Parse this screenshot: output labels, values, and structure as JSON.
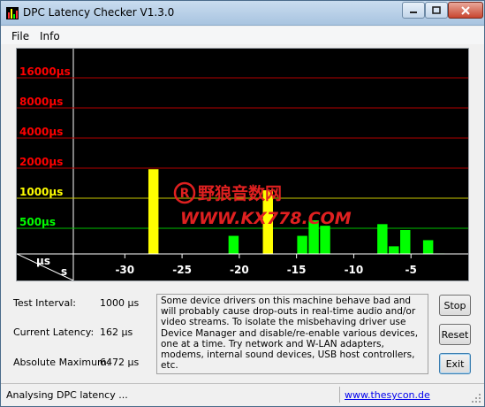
{
  "window": {
    "title": "DPC Latency Checker V1.3.0",
    "icon": "bar-chart-icon"
  },
  "menu": {
    "file": "File",
    "info": "Info"
  },
  "chart_data": {
    "type": "bar",
    "y_scale": "log",
    "y_tick_labels": [
      {
        "label": "16000µs",
        "value": 16000,
        "color": "#ff0000"
      },
      {
        "label": "8000µs",
        "value": 8000,
        "color": "#ff0000"
      },
      {
        "label": "4000µs",
        "value": 4000,
        "color": "#ff0000"
      },
      {
        "label": "2000µs",
        "value": 2000,
        "color": "#ff0000"
      },
      {
        "label": "1000µs",
        "value": 1000,
        "color": "#ffff00"
      },
      {
        "label": "500µs",
        "value": 500,
        "color": "#00ff00"
      }
    ],
    "x_tick_labels": [
      "-30",
      "-25",
      "-20",
      "-15",
      "-10",
      "-5"
    ],
    "x_ticks": [
      -30,
      -25,
      -20,
      -15,
      -10,
      -5
    ],
    "x_range": [
      -34.5,
      0
    ],
    "corner_labels": {
      "y_unit": "µs",
      "x_unit": "s"
    },
    "x": [
      -33.5,
      -32.5,
      -31.5,
      -30.5,
      -29.5,
      -28.5,
      -27.5,
      -26.5,
      -25.5,
      -24.5,
      -23.5,
      -22.5,
      -21.5,
      -20.5,
      -19.5,
      -18.5,
      -17.5,
      -16.5,
      -15.5,
      -14.5,
      -13.5,
      -12.5,
      -11.5,
      -10.5,
      -9.5,
      -8.5,
      -7.5,
      -6.5,
      -5.5,
      -4.5,
      -3.5,
      -2.5,
      -1.5,
      -0.5
    ],
    "values": [
      220,
      220,
      230,
      230,
      230,
      0,
      1950,
      160,
      170,
      230,
      230,
      220,
      230,
      420,
      230,
      230,
      1200,
      230,
      230,
      420,
      600,
      530,
      230,
      230,
      230,
      230,
      550,
      330,
      480,
      230,
      380,
      280,
      230,
      230
    ],
    "colors": {
      "low": "#00ff00",
      "mid": "#ffff00",
      "high": "#ff0000"
    },
    "thresholds": {
      "mid": 500,
      "high": 2000
    }
  },
  "watermark": {
    "name": "野狼音数网",
    "url": "WWW.KX778.COM",
    "mark": "R"
  },
  "stats": {
    "test_interval_label": "Test Interval:",
    "test_interval_value": "1000 µs",
    "current_latency_label": "Current Latency:",
    "current_latency_value": "162 µs",
    "absolute_maximum_label": "Absolute Maximum:",
    "absolute_maximum_value": "6472 µs"
  },
  "description": "Some device drivers on this machine behave bad and will probably cause drop-outs in real-time audio and/or video streams. To isolate the misbehaving driver use Device Manager and disable/re-enable various devices, one at a time. Try network and W-LAN adapters, modems, internal sound devices, USB host controllers, etc.",
  "buttons": {
    "stop": "Stop",
    "reset": "Reset",
    "exit": "Exit"
  },
  "status": {
    "text": "Analysing DPC latency ...",
    "link": "www.thesycon.de"
  }
}
